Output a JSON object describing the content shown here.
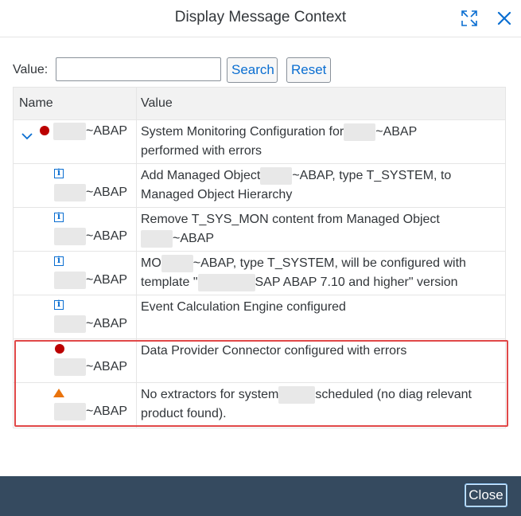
{
  "dialog": {
    "title": "Display Message Context",
    "maximize_icon": "maximize-icon",
    "close_icon": "close-icon"
  },
  "filter": {
    "label": "Value:",
    "value": "",
    "placeholder": "",
    "search_label": "Search",
    "reset_label": "Reset"
  },
  "table": {
    "columns": [
      "Name",
      "Value"
    ],
    "rows": [
      {
        "status": "error",
        "expanded": true,
        "name_suffix": "~ABAP",
        "value_parts": [
          "System Monitoring Configuration for",
          "~ABAP",
          "performed with errors"
        ]
      },
      {
        "status": "info",
        "name_suffix": "~ABAP",
        "value_parts": [
          "Add Managed Object",
          "~ABAP, type T_SYSTEM, to",
          "Managed Object Hierarchy"
        ]
      },
      {
        "status": "info",
        "name_suffix": "~ABAP",
        "value_parts": [
          "Remove T_SYS_MON content from Managed Object",
          "~ABAP"
        ]
      },
      {
        "status": "info",
        "name_suffix": "~ABAP",
        "value_parts": [
          "MO",
          "~ABAP, type T_SYSTEM, will be configured with",
          "template \"",
          "SAP ABAP 7.10 and higher\" version"
        ]
      },
      {
        "status": "info",
        "name_suffix": "~ABAP",
        "value_parts": [
          "Event Calculation Engine configured"
        ]
      },
      {
        "status": "error",
        "name_suffix": "~ABAP",
        "value_parts": [
          "Data Provider Connector configured with errors"
        ]
      },
      {
        "status": "warning",
        "name_suffix": "~ABAP",
        "value_parts": [
          "No extractors for system",
          "scheduled (no diag relevant",
          "product found)."
        ]
      }
    ]
  },
  "footer": {
    "close_label": "Close"
  },
  "colors": {
    "error": "#bb0000",
    "info": "#0a6ed1",
    "warning": "#e9730c",
    "highlight": "#e04848",
    "footer": "#354a5f"
  }
}
